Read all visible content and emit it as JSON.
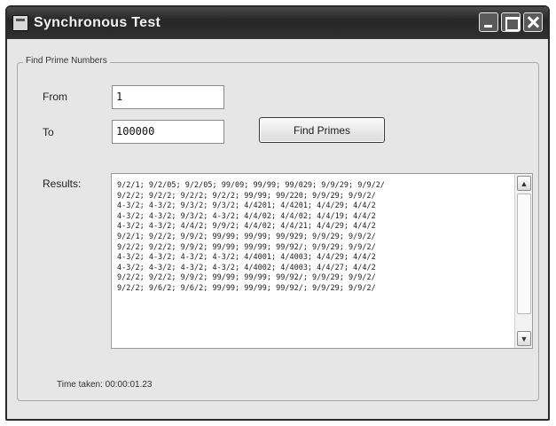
{
  "window": {
    "title": "Synchronous Test"
  },
  "group": {
    "legend": "Find Prime Numbers"
  },
  "form": {
    "from_label": "From",
    "from_value": "1",
    "to_label": "To",
    "to_value": "100000",
    "find_button_label": "Find Primes",
    "results_label": "Results:"
  },
  "results": {
    "lines": [
      "9/2/1; 9/2/05; 9/2/05; 99/09; 99/99; 99/029; 9/9/29; 9/9/2/",
      "9/2/2; 9/2/2; 9/2/2; 9/2/2; 99/99; 99/220; 9/9/29; 9/9/2/",
      "4-3/2; 4-3/2; 9/3/2; 9/3/2; 4/4201; 4/4201; 4/4/29; 4/4/2",
      "4-3/2; 4-3/2; 9/3/2; 4-3/2; 4/4/02; 4/4/02; 4/4/19; 4/4/2",
      "4-3/2; 4-3/2; 4/4/2; 9/9/2; 4/4/02; 4/4/21; 4/4/29; 4/4/2",
      "9/2/1; 9/2/2; 9/9/2; 99/99; 99/99; 99/929; 9/9/29; 9/9/2/",
      "9/2/2; 9/2/2; 9/9/2; 99/99; 99/99; 99/92/; 9/9/29; 9/9/2/",
      "4-3/2; 4-3/2; 4-3/2; 4-3/2; 4/4001; 4/4003; 4/4/29; 4/4/2",
      "4-3/2; 4-3/2; 4-3/2; 4-3/2; 4/4002; 4/4003; 4/4/27; 4/4/2",
      "9/2/2; 9/2/2; 9/9/2; 99/99; 99/99; 99/92/; 9/9/29; 9/9/2/",
      "9/2/2; 9/6/2; 9/6/2; 99/99; 99/99; 99/92/; 9/9/29; 9/9/2/"
    ]
  },
  "status": {
    "text": "Time taken: 00:00:01.23"
  }
}
